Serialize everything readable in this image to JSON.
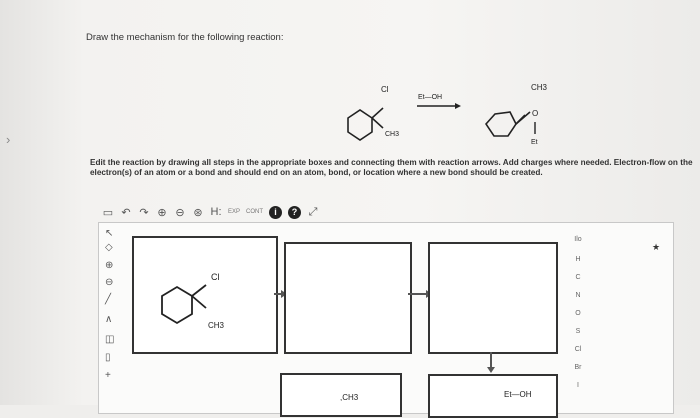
{
  "prompt": "Draw the mechanism for the following reaction:",
  "reaction": {
    "reactant_cl": "Cl",
    "reactant_methyl": "CH3",
    "reagent": "Et—OH",
    "product_methyl": "CH3",
    "product_o": "O",
    "product_et": "Et"
  },
  "instructions": "Edit the reaction by drawing all steps in the appropriate boxes and connecting them with reaction arrows. Add charges where needed. Electron-flow on the electron(s) of an atom or a bond and should end on an atom, bond, or location where a new bond should be created.",
  "toolbar": {
    "tools": [
      {
        "name": "new-icon",
        "glyph": "▭"
      },
      {
        "name": "undo-icon",
        "glyph": "↶"
      },
      {
        "name": "redo-icon",
        "glyph": "↷"
      },
      {
        "name": "zoom-in-icon",
        "glyph": "⊕"
      },
      {
        "name": "zoom-out-icon",
        "glyph": "⊖"
      },
      {
        "name": "zoom-reset-icon",
        "glyph": "⊛"
      },
      {
        "name": "h-lonepair-icon",
        "glyph": "H:"
      },
      {
        "name": "exp-icon",
        "glyph": "EXP"
      },
      {
        "name": "cont-icon",
        "glyph": "CONT"
      },
      {
        "name": "info-icon",
        "glyph": "i"
      },
      {
        "name": "help-icon",
        "glyph": "?"
      },
      {
        "name": "expand-icon",
        "glyph": "⤢"
      }
    ]
  },
  "left_tools": [
    {
      "name": "select-arrow-icon",
      "glyph": "↖"
    },
    {
      "name": "eraser-icon",
      "glyph": "◇"
    },
    {
      "name": "plus-charge-icon",
      "glyph": "⊕"
    },
    {
      "name": "minus-charge-icon",
      "glyph": "⊖"
    },
    {
      "name": "bond-icon",
      "glyph": "╱"
    },
    {
      "name": "chain-icon",
      "glyph": "∧"
    },
    {
      "name": "ring-icon",
      "glyph": "◫"
    },
    {
      "name": "template-icon",
      "glyph": "▯"
    },
    {
      "name": "plus-icon",
      "glyph": "+"
    }
  ],
  "editor": {
    "box1_cl": "Cl",
    "box1_methyl": "CH3",
    "bottom_left_methyl": ",CH3",
    "bottom_right_reagent": "Et—OH"
  },
  "elements": [
    "H",
    "C",
    "N",
    "O",
    "S",
    "Cl",
    "Br",
    "I"
  ],
  "element_panel_header": "Ilo"
}
